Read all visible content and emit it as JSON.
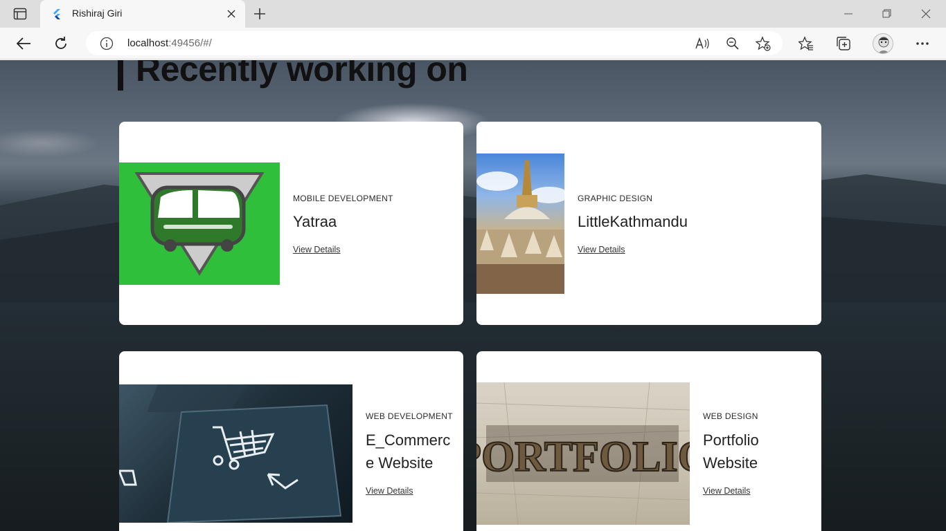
{
  "browser": {
    "tab_title": "Rishiraj Giri",
    "url_host": "localhost",
    "url_rest": ":49456/#/"
  },
  "page": {
    "section_title": "Recently working on"
  },
  "projects": [
    {
      "category": "MOBILE DEVELOPMENT",
      "title": "Yatraa",
      "link": "View Details"
    },
    {
      "category": "GRAPHIC DESIGN",
      "title": "LittleKathmandu",
      "link": "View Details"
    },
    {
      "category": "WEB DEVELOPMENT",
      "title": "E_Commerc\ne Website",
      "link": "View Details"
    },
    {
      "category": "WEB DESIGN",
      "title": "Portfolio\nWebsite",
      "link": "View Details"
    }
  ],
  "portfolio_logo_text": "PORTFOLIO",
  "colors": {
    "yatraa_bg": "#2fbf3a",
    "card_bg": "#ffffff"
  }
}
